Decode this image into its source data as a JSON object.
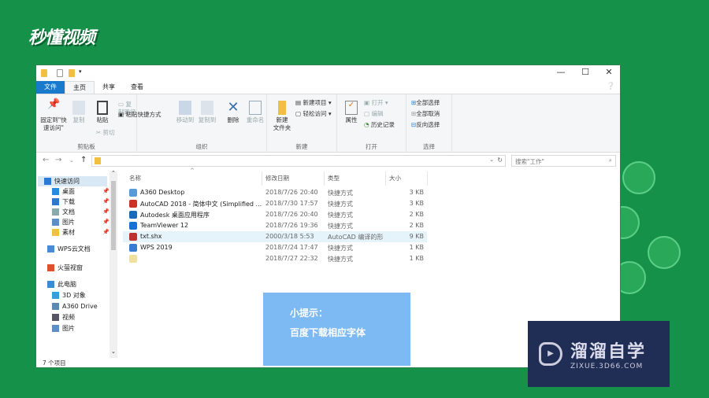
{
  "logo": "秒懂视频",
  "window": {
    "controls": {
      "minimize": "—",
      "maximize": "☐",
      "close": "✕"
    },
    "tabs": [
      {
        "label": "文件"
      },
      {
        "label": "主页"
      },
      {
        "label": "共享"
      },
      {
        "label": "查看"
      }
    ],
    "ribbon": {
      "clipboard": {
        "label": "剪贴板",
        "pin": "固定到\"快\n速访问\"",
        "copy": "复制",
        "paste": "粘贴",
        "copy_path": "复制路径",
        "paste_shortcut": "粘贴快捷方式",
        "cut": "剪切"
      },
      "organize": {
        "label": "组织",
        "move_to": "移动到",
        "copy_to": "复制到",
        "delete": "删除",
        "rename": "重命名"
      },
      "new": {
        "label": "新建",
        "new_folder": "新建\n文件夹",
        "new_item": "新建项目 ▾",
        "easy_access": "轻松访问 ▾"
      },
      "open": {
        "label": "打开",
        "properties": "属性",
        "open": "打开 ▾",
        "edit": "编辑",
        "history": "历史记录"
      },
      "select": {
        "label": "选择",
        "select_all": "全部选择",
        "select_none": "全部取消",
        "invert": "反向选择"
      }
    },
    "search_placeholder": "搜索\"工作\"",
    "nav": [
      {
        "label": "快速访问",
        "color": "#2a7ad5"
      },
      {
        "label": "桌面",
        "color": "#2a8ae0",
        "pinned": true
      },
      {
        "label": "下载",
        "color": "#2a7ad5",
        "pinned": true
      },
      {
        "label": "文档",
        "color": "#8aa",
        "pinned": true
      },
      {
        "label": "图片",
        "color": "#5b8fc9",
        "pinned": true
      },
      {
        "label": "素材",
        "color": "#f0c040",
        "pinned": true
      },
      {
        "label": "WPS云文档",
        "color": "#4a8ad5"
      },
      {
        "label": "火萤视窗",
        "color": "#e05030"
      },
      {
        "label": "此电脑",
        "color": "#3a8ad5"
      },
      {
        "label": "3D 对象",
        "color": "#30a0e0"
      },
      {
        "label": "A360 Drive",
        "color": "#5a8ab5"
      },
      {
        "label": "视频",
        "color": "#556"
      },
      {
        "label": "图片",
        "color": "#5b8fc9"
      }
    ],
    "columns": {
      "name": "名称",
      "date": "修改日期",
      "type": "类型",
      "size": "大小"
    },
    "files": [
      {
        "name": "A360 Desktop",
        "date": "2018/7/26 20:40",
        "type": "快捷方式",
        "size": "3 KB",
        "color": "#5a9ad5"
      },
      {
        "name": "AutoCAD 2018 - 简体中文 (Simplified ...",
        "date": "2018/7/30 17:57",
        "type": "快捷方式",
        "size": "3 KB",
        "color": "#d0302a"
      },
      {
        "name": "Autodesk 桌面应用程序",
        "date": "2018/7/26 20:40",
        "type": "快捷方式",
        "size": "2 KB",
        "color": "#1a6ab5"
      },
      {
        "name": "TeamViewer 12",
        "date": "2018/7/26 19:36",
        "type": "快捷方式",
        "size": "2 KB",
        "color": "#1a70d0"
      },
      {
        "name": "txt.shx",
        "date": "2000/3/18 5:53",
        "type": "AutoCAD 编译的形",
        "size": "9 KB",
        "color": "#c03030"
      },
      {
        "name": "WPS 2019",
        "date": "2018/7/24 17:47",
        "type": "快捷方式",
        "size": "1 KB",
        "color": "#3a7ad5"
      },
      {
        "name": "",
        "date": "2018/7/27 22:32",
        "type": "快捷方式",
        "size": "1 KB",
        "color": "#f0e0a0"
      }
    ],
    "status": "7 个项目"
  },
  "tip": {
    "title": "小提示：",
    "text": "百度下载相应字体"
  },
  "brand": {
    "name": "溜溜自学",
    "url": "ZIXUE.3D66.COM"
  }
}
